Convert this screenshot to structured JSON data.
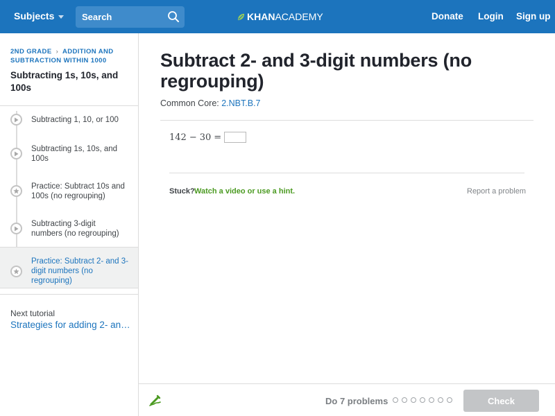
{
  "header": {
    "subjects_label": "Subjects",
    "search_placeholder": "Search",
    "logo_part1": "KHAN",
    "logo_part2": "ACADEMY",
    "donate_label": "Donate",
    "login_label": "Login",
    "signup_label": "Sign up"
  },
  "sidebar": {
    "breadcrumb_1": "2ND GRADE",
    "breadcrumb_2": "ADDITION AND SUBTRACTION WITHIN 1000",
    "title": "Subtracting 1s, 10s, and 100s",
    "items": [
      {
        "label": "Subtracting 1, 10, or 100",
        "type": "video"
      },
      {
        "label": "Subtracting 1s, 10s, and 100s",
        "type": "video"
      },
      {
        "label": "Practice: Subtract 10s and 100s (no regrouping)",
        "type": "practice"
      },
      {
        "label": "Subtracting 3-digit numbers (no regrouping)",
        "type": "video"
      },
      {
        "label": "Practice: Subtract 2- and 3-digit numbers (no regrouping)",
        "type": "practice",
        "active": true
      }
    ],
    "next_label": "Next tutorial",
    "next_link": "Strategies for adding 2- an…"
  },
  "main": {
    "title": "Subtract 2- and 3-digit numbers (no regrouping)",
    "common_core_label": "Common Core:",
    "common_core_code": "2.NBT.B.7",
    "problem": {
      "operand1": "142",
      "operator": "−",
      "operand2": "30",
      "equals": "="
    },
    "stuck_label": "Stuck?",
    "hint_link": "Watch a video or use a hint.",
    "report_link": "Report a problem"
  },
  "footer": {
    "do_problems": "Do 7 problems",
    "progress_dots": 7,
    "check_label": "Check"
  },
  "colors": {
    "header_bg": "#1c74bd",
    "link_blue": "#1c74bd",
    "hint_green": "#4b9a21",
    "check_disabled": "#c3c5c7"
  }
}
